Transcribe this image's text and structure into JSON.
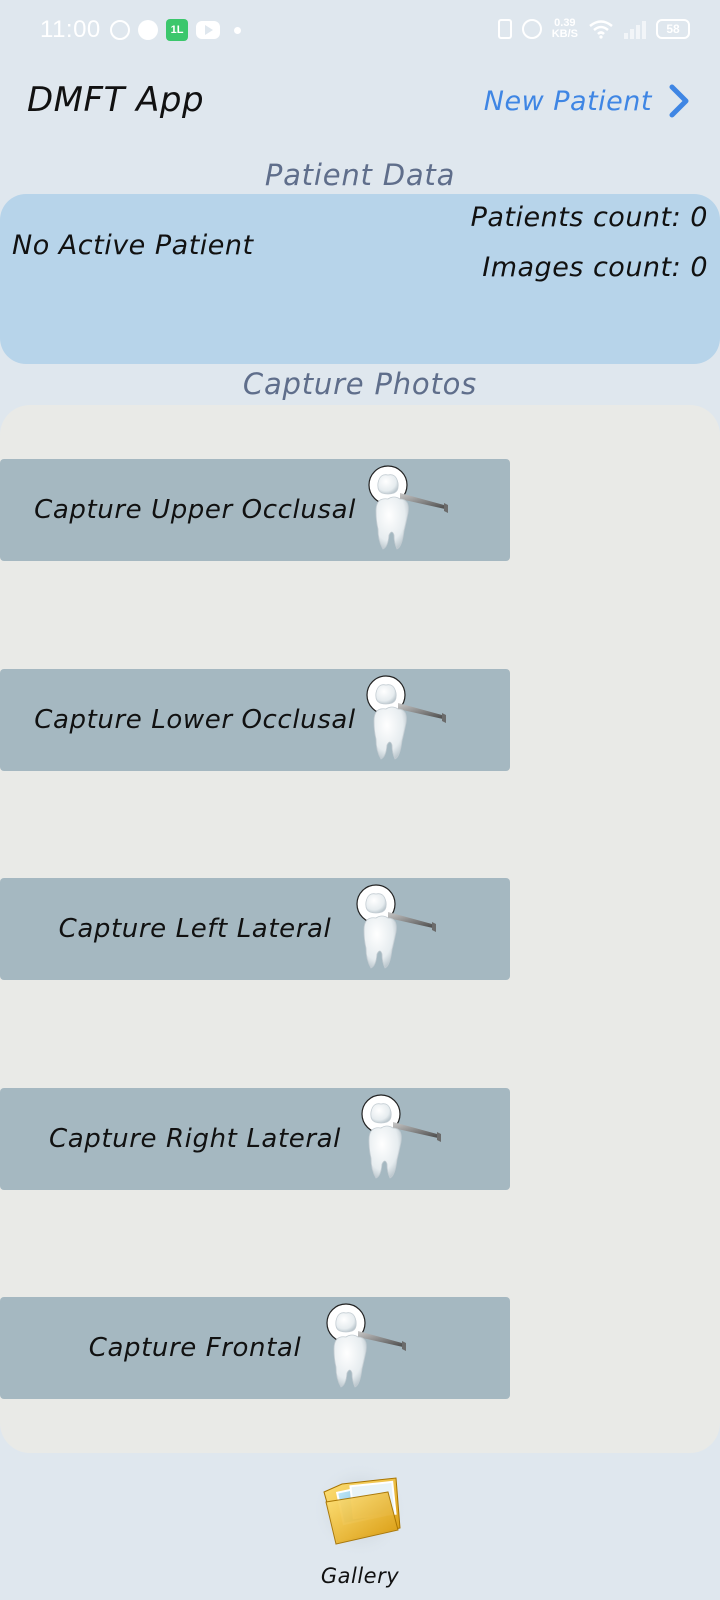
{
  "status_bar": {
    "time": "11:00",
    "left_icons": [
      "whatsapp-icon",
      "messenger-icon",
      "app-notification-icon",
      "youtube-icon",
      "dot-icon"
    ],
    "green_app_glyph": "1L",
    "net_speed_value": "0.39",
    "net_speed_unit": "KB/S",
    "battery": "58"
  },
  "header": {
    "title": "DMFT App",
    "new_patient_label": "New Patient"
  },
  "patient_section": {
    "title": "Patient Data",
    "status": "No Active Patient",
    "patients_count": "Patients count: 0",
    "images_count": "Images count: 0"
  },
  "capture_section": {
    "title": "Capture Photos",
    "buttons": [
      {
        "label": "Capture Upper Occlusal"
      },
      {
        "label": "Capture Lower Occlusal"
      },
      {
        "label": "Capture Left Lateral"
      },
      {
        "label": "Capture Right Lateral"
      },
      {
        "label": "Capture Frontal"
      }
    ]
  },
  "gallery": {
    "label": "Gallery"
  },
  "colors": {
    "background": "#dfe7ee",
    "accent": "#3f86e4",
    "patient_card": "#b7d4ea",
    "capture_panel": "#e9eae7",
    "capture_button": "#a5b8c1",
    "section_title": "#5f6e8b"
  }
}
